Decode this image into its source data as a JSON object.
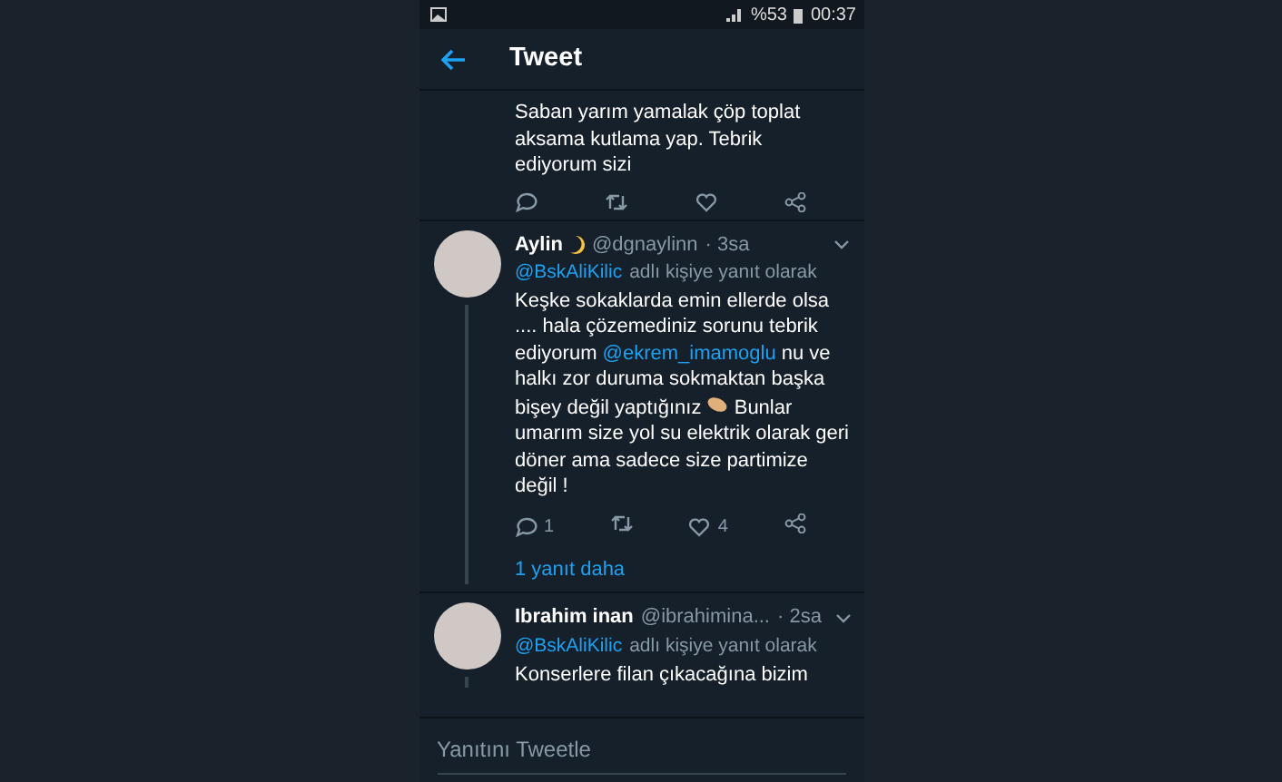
{
  "status_bar": {
    "battery": "%53",
    "time": "00:37"
  },
  "header": {
    "title": "Tweet"
  },
  "tweets": [
    {
      "kind": "partial",
      "parts": [
        {
          "kind": "text",
          "text": "Saban yarım yamalak çöp toplat aksama kutlama yap. Tebrik ediyorum sizi"
        }
      ]
    },
    {
      "kind": "full",
      "name": "Aylin",
      "handle": "@dgnaylinn",
      "time": "· 3sa",
      "reply_to": "@BskAliKilic",
      "reply_suffix": "adlı kişiye yanıt olarak",
      "parts": [
        {
          "kind": "text",
          "text": "Keşke sokaklarda emin ellerde olsa .... hala çözemediniz sorunu tebrik ediyorum "
        },
        {
          "kind": "mention",
          "text": "@ekrem_imamoglu"
        },
        {
          "kind": "text",
          "text": " nu ve halkı zor duruma sokmaktan başka bişey değil yaptığınız "
        },
        {
          "kind": "emoji"
        },
        {
          "kind": "text",
          "text": " Bunlar umarım size yol su elektrik olarak geri döner ama sadece size partimize değil !"
        }
      ],
      "replies": "1",
      "likes": "4",
      "more": "1 yanıt daha"
    },
    {
      "kind": "cut",
      "name": "Ibrahim inan",
      "handle": "@ibrahimina...",
      "time": "· 2sa",
      "reply_to": "@BskAliKilic",
      "reply_suffix": "adlı kişiye yanıt olarak",
      "parts": [
        {
          "kind": "text",
          "text": "Konserlere filan çıkacağına bizim"
        }
      ]
    }
  ],
  "composer": {
    "placeholder": "Yanıtını Tweetle"
  }
}
